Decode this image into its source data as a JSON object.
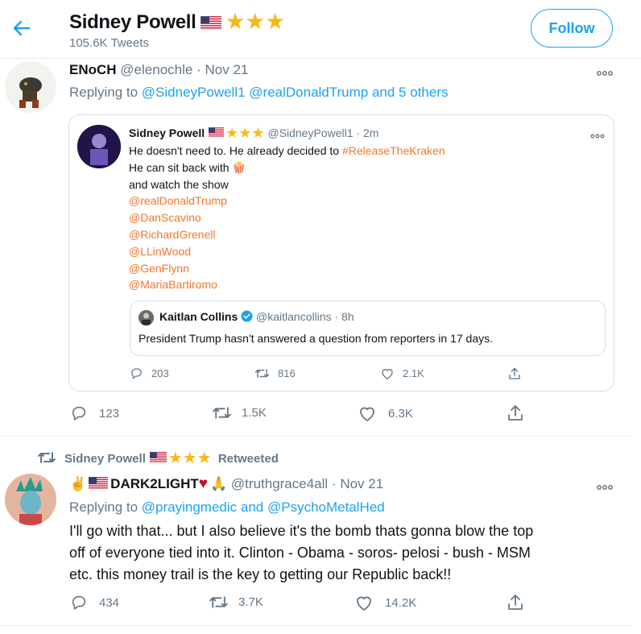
{
  "header": {
    "name": "Sidney Powell",
    "tweets_count": "105.6K Tweets",
    "follow_label": "Follow"
  },
  "tweet1": {
    "name": "ENoCH",
    "handle": "@elenochle",
    "sep": "·",
    "date": "Nov 21",
    "replying_prefix": "Replying to",
    "replying_to": "@SidneyPowell1 @realDonaldTrump and 5 others",
    "quoted": {
      "name": "Sidney Powell",
      "handle": "@SidneyPowell1",
      "sep": "·",
      "time": "2m",
      "line1_text": "He doesn't need to. He already decided to",
      "line1_tag": "#ReleaseTheKraken",
      "line2_text": "He can sit back with",
      "line2_emoji": "🍿",
      "line3_text": "and watch the show",
      "mentions": [
        "@realDonaldTrump",
        "@DanScavino",
        "@RichardGrenell",
        "@LLinWood",
        "@GenFlynn",
        "@MariaBartiromo"
      ],
      "inner": {
        "name": "Kaitlan Collins",
        "handle": "@kaitlancollins",
        "sep": "·",
        "time": "8h",
        "text": "President Trump hasn't answered a question from reporters in 17 days."
      },
      "stats": {
        "replies": "203",
        "retweets": "816",
        "likes": "2.1K"
      }
    },
    "stats": {
      "replies": "123",
      "retweets": "1.5K",
      "likes": "6.3K"
    }
  },
  "tweet2": {
    "retweeted_by": "Sidney Powell",
    "retweeted_label": "Retweeted",
    "name_prefix_emoji": "✌️",
    "name": "DARK2LIGHT",
    "name_suffix_emoji": "🙏",
    "handle": "@truthgrace4all",
    "sep": "·",
    "date": "Nov 21",
    "replying_prefix": "Replying to",
    "replying_to": "@prayingmedic and @PsychoMetalHed",
    "text_line1": "I'll go with that... but I also believe it's the bomb thats gonna blow the top",
    "text_line2": "off of everyone tied into it. Clinton - Obama - soros-  pelosi - bush - MSM",
    "text_line3": "etc. this money trail is the key to getting our Republic back!!",
    "stats": {
      "replies": "434",
      "retweets": "3.7K",
      "likes": "14.2K"
    }
  },
  "colors": {
    "accent": "#1da1f2",
    "hashtag": "#f4762a",
    "muted": "#657786",
    "star": "#f6b81b",
    "heart": "#c8102e"
  }
}
